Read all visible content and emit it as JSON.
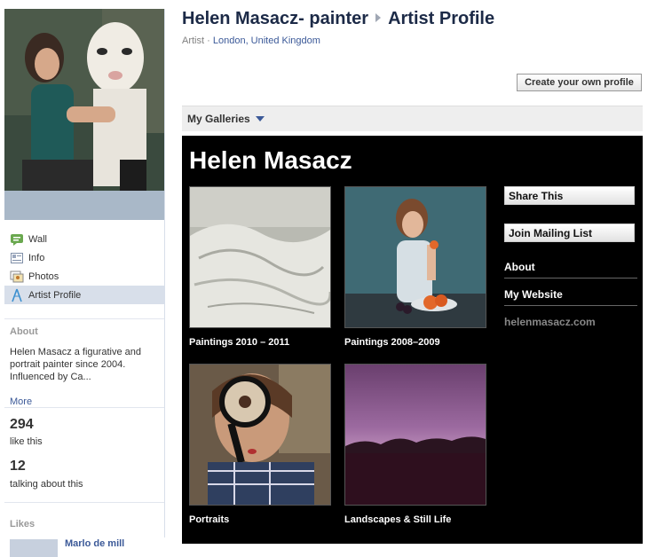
{
  "header": {
    "page_name": "Helen Masacz- painter",
    "section": "Artist Profile",
    "category": "Artist",
    "separator": "·",
    "location": "London, United Kingdom"
  },
  "actions": {
    "create_profile": "Create your own profile"
  },
  "sidebar": {
    "nav": [
      {
        "label": "Wall",
        "icon": "wall-icon"
      },
      {
        "label": "Info",
        "icon": "info-icon"
      },
      {
        "label": "Photos",
        "icon": "photos-icon"
      },
      {
        "label": "Artist Profile",
        "icon": "artist-profile-icon",
        "active": true
      }
    ],
    "about_heading": "About",
    "about_text": "Helen Masacz a figurative and portrait painter since 2004. Influenced by Ca...",
    "more": "More",
    "likes_count": "294",
    "likes_label": "like this",
    "talking_count": "12",
    "talking_label": "talking about this",
    "likes_heading": "Likes",
    "likes_item": "Marlo de mill"
  },
  "galleries": {
    "menu_label": "My Galleries",
    "artist_name": "Helen Masacz",
    "items": [
      {
        "caption": "Paintings 2010 – 2011"
      },
      {
        "caption": "Paintings 2008–2009"
      },
      {
        "caption": "Portraits"
      },
      {
        "caption": "Landscapes & Still Life"
      }
    ],
    "share": "Share This",
    "mailing": "Join Mailing List",
    "about": "About",
    "website": "My Website",
    "url": "helenmasacz.com"
  },
  "colors": {
    "link": "#3b5998",
    "title": "#1c2a47",
    "panel": "#000000"
  }
}
